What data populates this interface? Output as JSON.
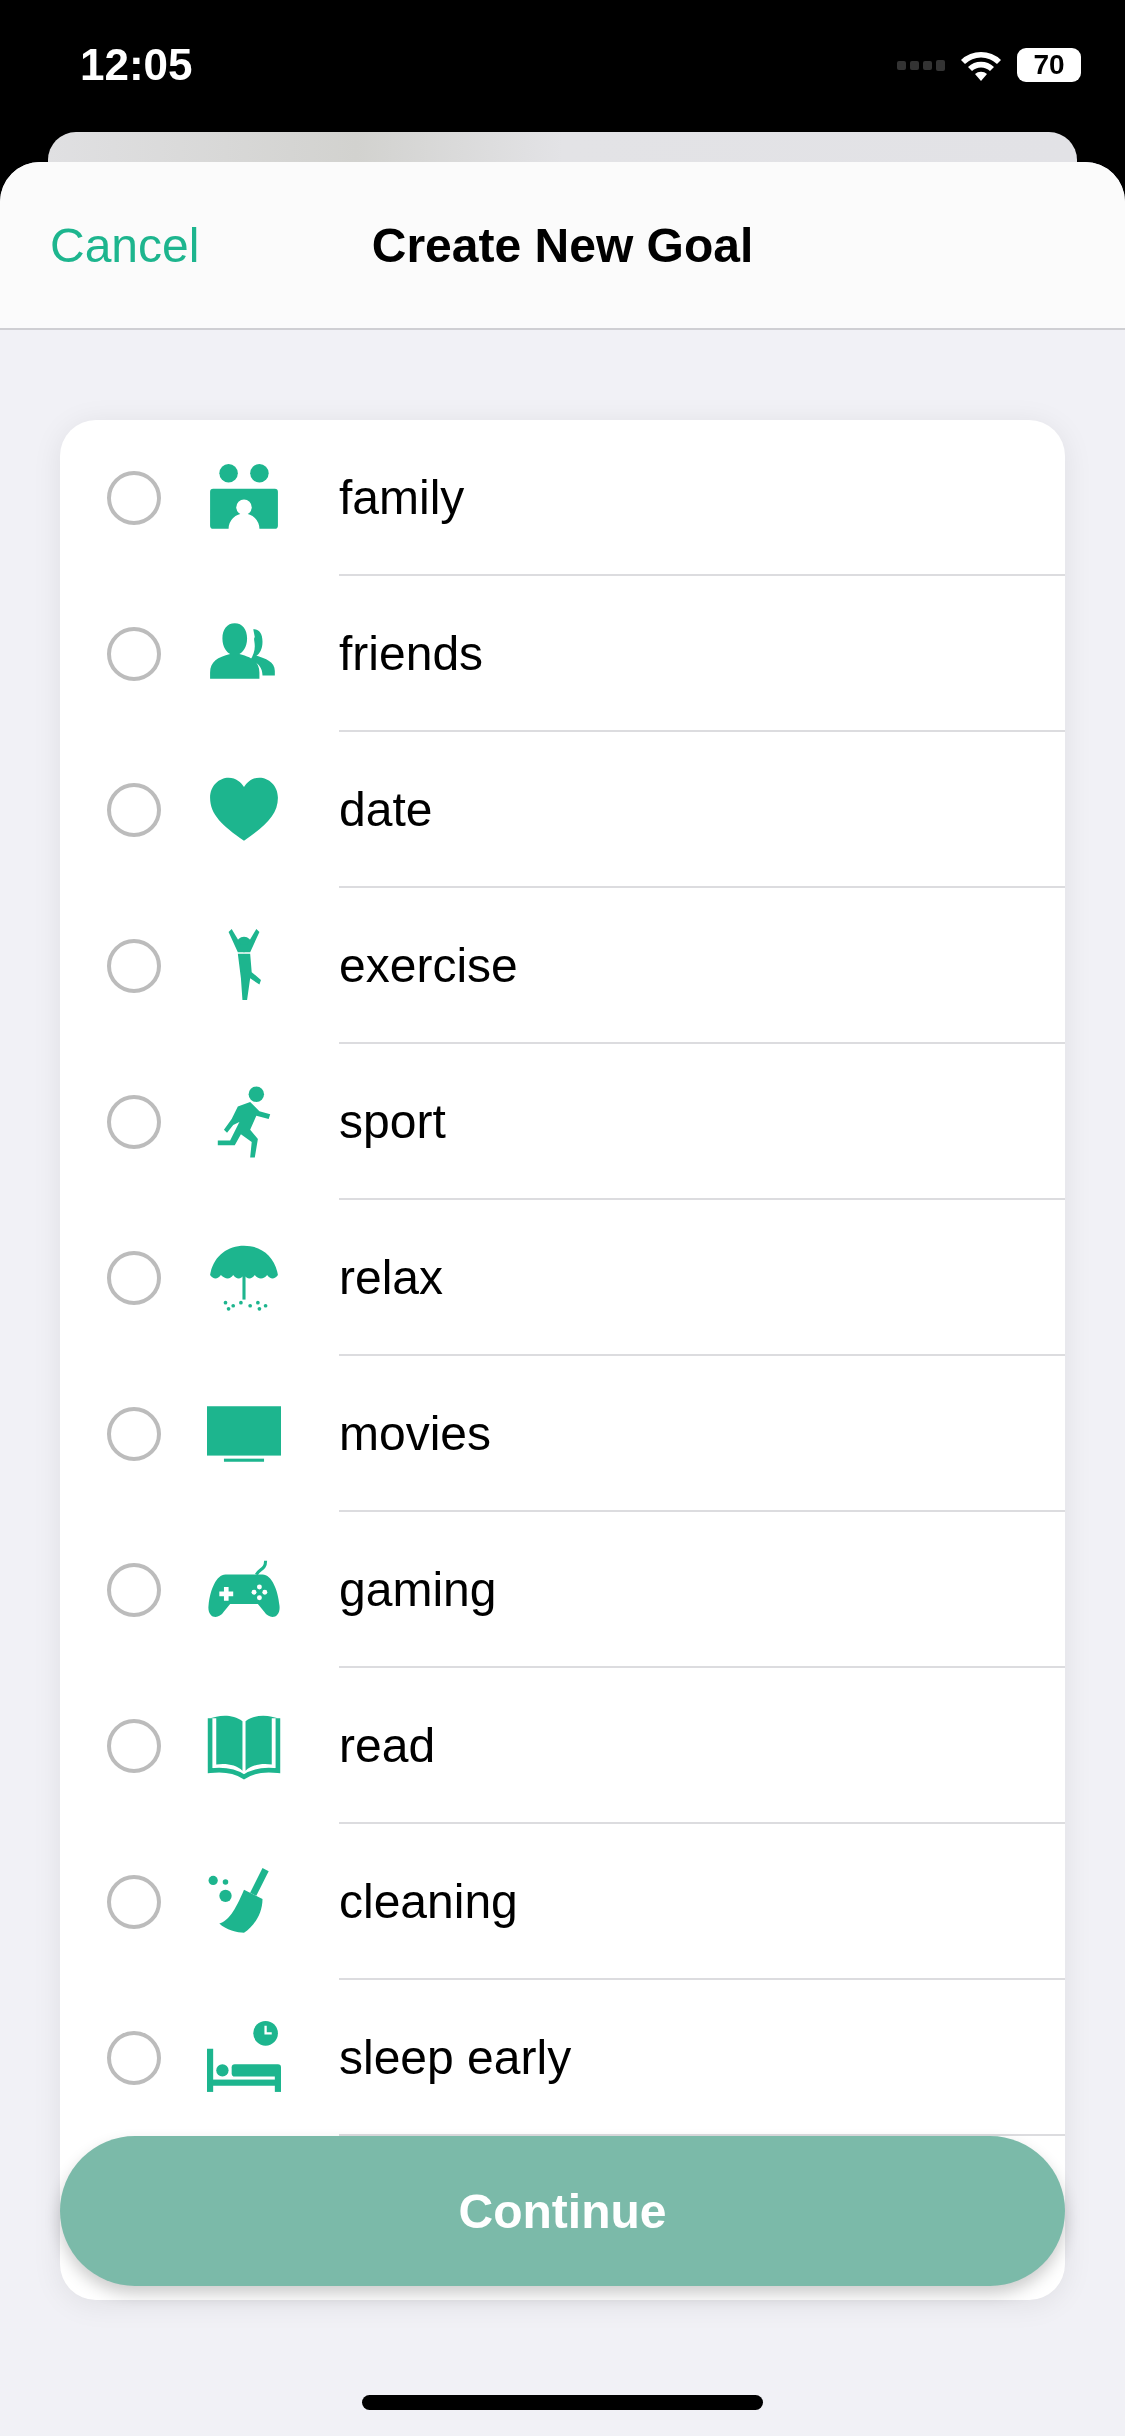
{
  "status_bar": {
    "time": "12:05",
    "battery": "70"
  },
  "header": {
    "cancel": "Cancel",
    "title": "Create New Goal"
  },
  "goals": [
    {
      "label": "family",
      "selected": false
    },
    {
      "label": "friends",
      "selected": false
    },
    {
      "label": "date",
      "selected": false
    },
    {
      "label": "exercise",
      "selected": false
    },
    {
      "label": "sport",
      "selected": false
    },
    {
      "label": "relax",
      "selected": false
    },
    {
      "label": "movies",
      "selected": false
    },
    {
      "label": "gaming",
      "selected": false
    },
    {
      "label": "read",
      "selected": false
    },
    {
      "label": "cleaning",
      "selected": false
    },
    {
      "label": "sleep early",
      "selected": false
    }
  ],
  "continue_button": "Continue"
}
